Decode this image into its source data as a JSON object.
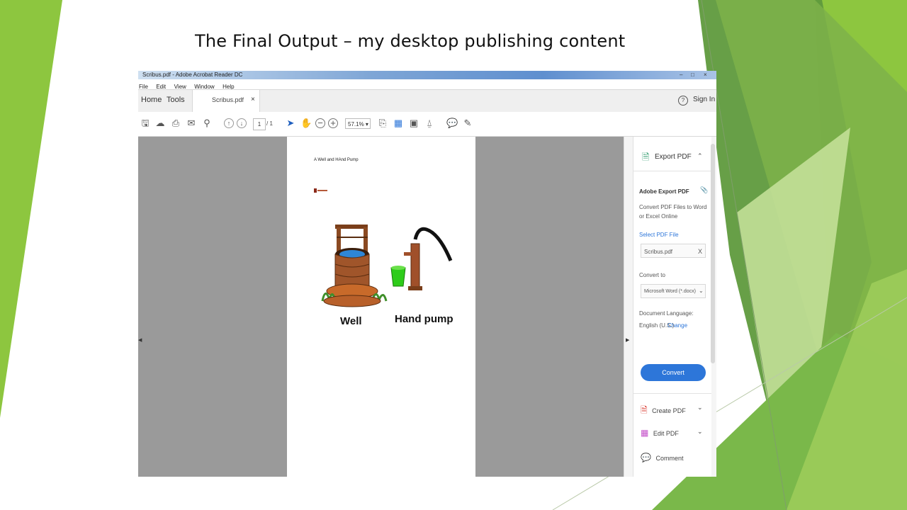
{
  "slide": {
    "title": "The Final Output – my desktop publishing content"
  },
  "window": {
    "title": "Scribus.pdf - Adobe Acrobat Reader DC",
    "controls": [
      "–",
      "□",
      "×"
    ],
    "menu": [
      "File",
      "Edit",
      "View",
      "Window",
      "Help"
    ],
    "tabs": {
      "home": "Home",
      "tools": "Tools",
      "doc_tab": "Scribus.pdf",
      "close": "×"
    },
    "help_icon": "?",
    "sign_in": "Sign In"
  },
  "toolbar": {
    "icons": [
      "save-icon",
      "cloud-upload-icon",
      "print-icon",
      "email-icon",
      "search-icon",
      "page-up-icon",
      "page-down-icon",
      "select-cursor-icon",
      "hand-icon",
      "zoom-out-icon",
      "zoom-in-icon",
      "fit-page-icon",
      "page-view-icon",
      "read-mode-icon",
      "marquee-icon",
      "comment-icon",
      "pen-icon"
    ],
    "page_current": "1",
    "page_total": "/ 1",
    "zoom": "57.1%"
  },
  "document": {
    "heading": "A Well and HAnd Pump",
    "captions": {
      "well": "Well",
      "pump": "Hand pump"
    }
  },
  "right_pane": {
    "section_title": "Export PDF",
    "panel_title": "Adobe Export PDF",
    "description_line1": "Convert PDF Files to Word",
    "description_line2": "or Excel Online",
    "select_label": "Select PDF File",
    "file_value": "Scribus.pdf",
    "clear": "X",
    "convert_to_label": "Convert to",
    "convert_to_value": "Microsoft Word (*.docx)",
    "doc_lang_label": "Document Language:",
    "doc_lang_value": "English (U.S.)",
    "change_link": "Change",
    "convert_button": "Convert",
    "tools": [
      {
        "label": "Create PDF"
      },
      {
        "label": "Edit PDF"
      },
      {
        "label": "Comment"
      }
    ]
  },
  "colors": {
    "green_light": "#8dc63f",
    "green_mid": "#6aa84f",
    "green_dark": "#5a8f3c",
    "accent_blue": "#2d76d9",
    "viewer_gray": "#9a9a9a"
  }
}
